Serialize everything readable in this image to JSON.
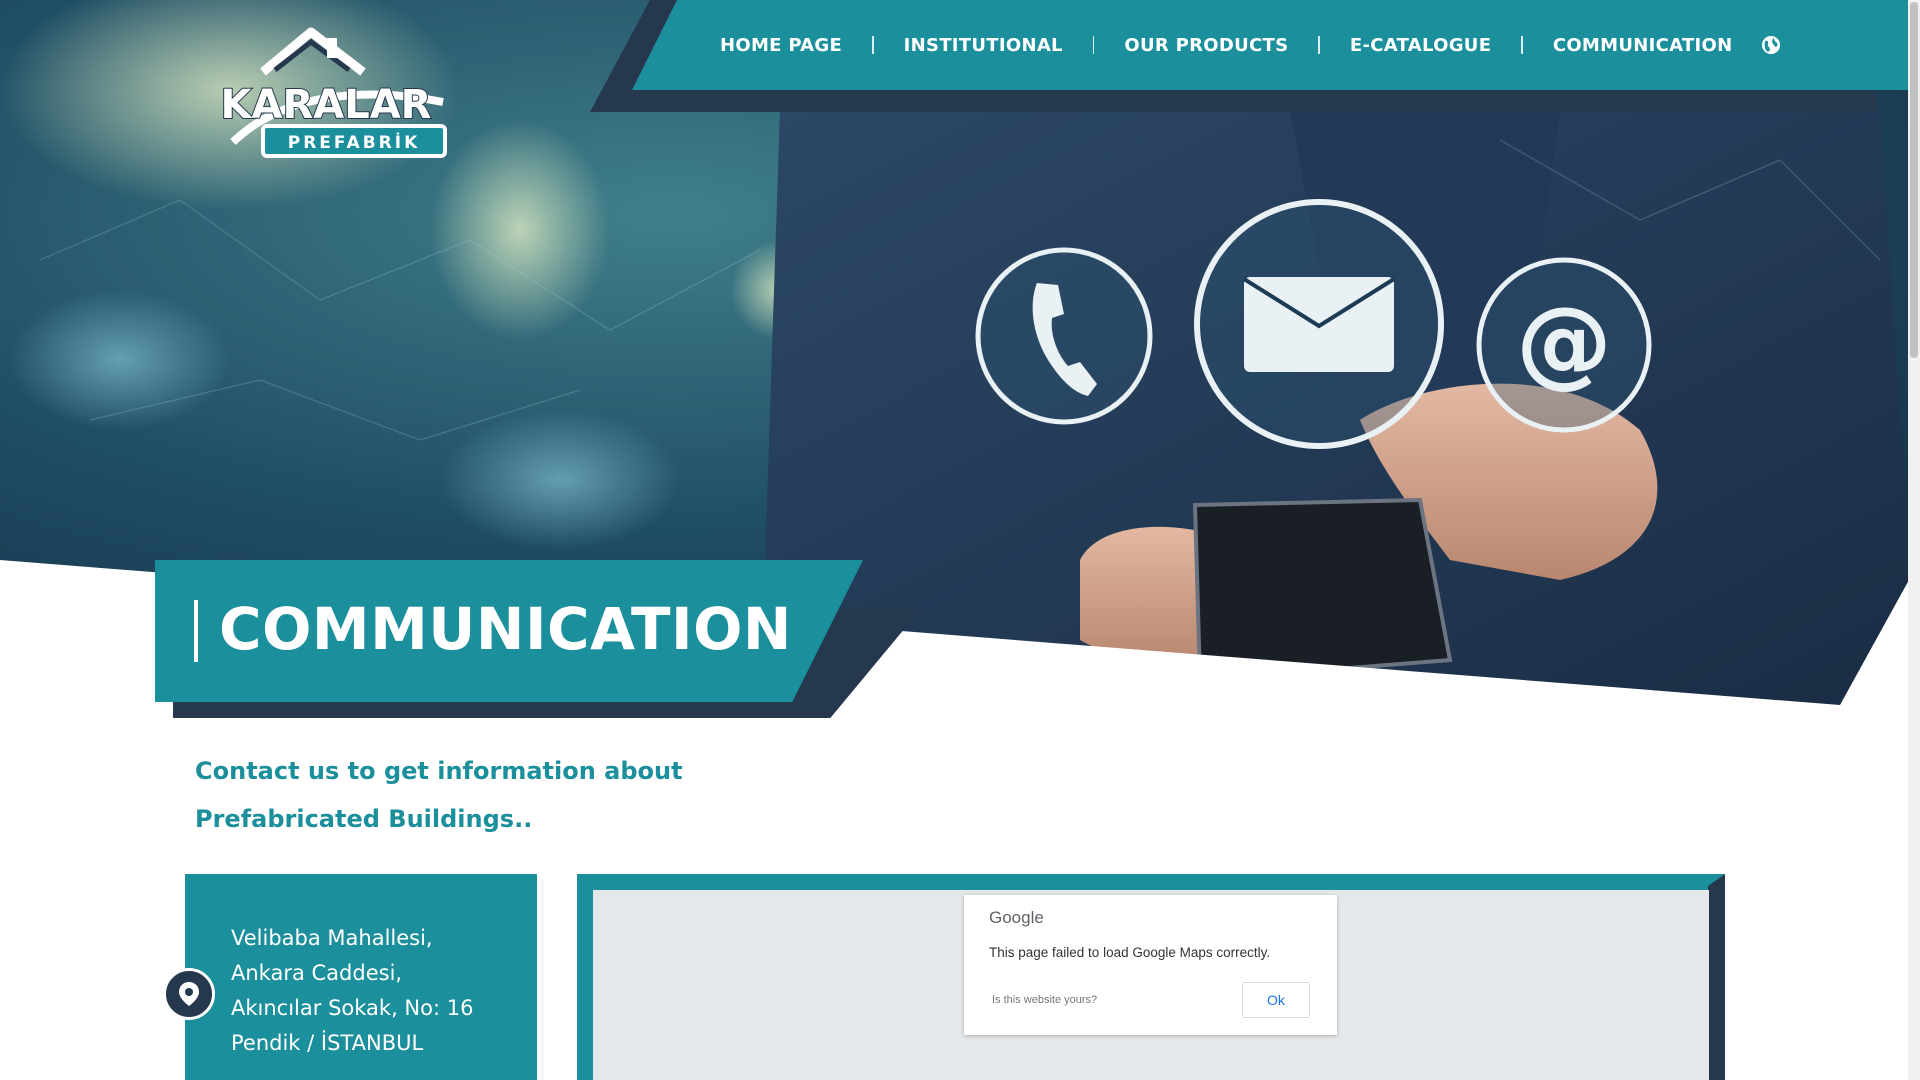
{
  "logo": {
    "brand": "KARALAR",
    "sub": "PREFABRİK"
  },
  "nav": {
    "items": [
      {
        "label": "HOME PAGE"
      },
      {
        "label": "INSTITUTIONAL"
      },
      {
        "label": "OUR PRODUCTS"
      },
      {
        "label": "E-CATALOGUE"
      },
      {
        "label": "COMMUNICATION"
      }
    ],
    "language_icon": "globe-icon"
  },
  "hero": {
    "icons": [
      "phone-icon",
      "envelope-icon",
      "at-sign-icon"
    ],
    "at_glyph": "@"
  },
  "page": {
    "title": "COMMUNICATION",
    "tagline_line1": "Contact us to get information about",
    "tagline_line2": "Prefabricated Buildings.."
  },
  "address": {
    "icon": "map-pin-icon",
    "lines": [
      "Velibaba Mahallesi,",
      "Ankara Caddesi,",
      "Akıncılar Sokak, No: 16",
      "Pendik / İSTANBUL"
    ]
  },
  "map": {
    "provider_logo": "Google",
    "error_message": "This page failed to load Google Maps correctly.",
    "question": "Is this website yours?",
    "ok_label": "Ok"
  },
  "colors": {
    "teal": "#1b8f9c",
    "navy": "#26384d",
    "white": "#ffffff"
  }
}
